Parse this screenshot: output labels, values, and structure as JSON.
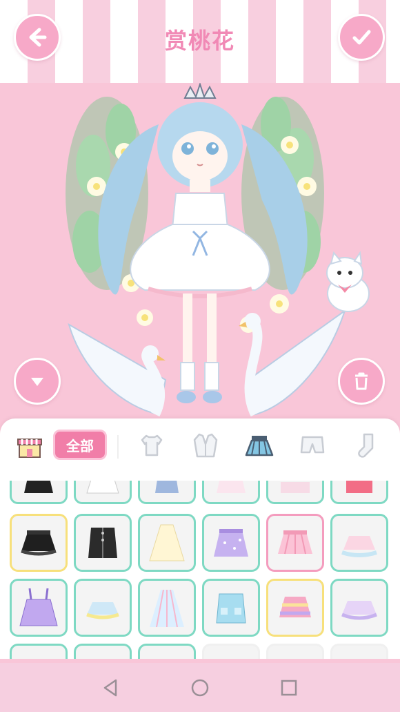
{
  "header": {
    "title": "赏桃花"
  },
  "buttons": {
    "back": {
      "icon": "back-arrow-icon"
    },
    "confirm": {
      "icon": "checkmark-icon"
    },
    "collapse": {
      "icon": "chevron-down-icon"
    },
    "delete": {
      "icon": "trash-icon"
    }
  },
  "categories": {
    "shop_icon": "shop-icon",
    "all_label": "全部",
    "items": [
      {
        "icon": "shirt-icon"
      },
      {
        "icon": "jacket-icon"
      },
      {
        "icon": "skirt-icon",
        "selected": true
      },
      {
        "icon": "shorts-icon"
      },
      {
        "icon": "sock-icon"
      }
    ]
  },
  "colors": {
    "accent_pink": "#f17ea8",
    "background_pink": "#f9c6d8",
    "cell_border_teal": "#7ed9c3",
    "cell_border_yellow": "#f7e07b",
    "cell_border_pink": "#f49cbe"
  },
  "navigation": {
    "back": "nav-back-icon",
    "home": "nav-home-icon",
    "recents": "nav-recents-icon"
  }
}
